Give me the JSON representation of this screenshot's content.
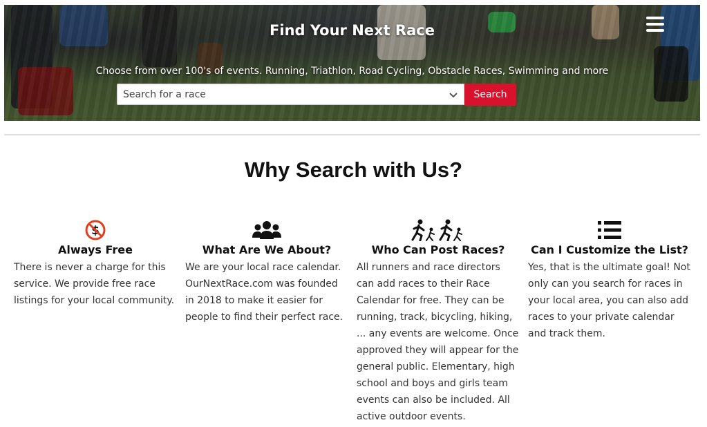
{
  "hero": {
    "title": "Find Your Next Race",
    "subtitle": "Choose from over 100's of events. Running, Triathlon, Road Cycling, Obstacle Races, Swimming and more",
    "menu_icon": "hamburger-menu-icon"
  },
  "search": {
    "placeholder": "Search for a race",
    "button_label": "Search",
    "button_color": "#d9112d"
  },
  "why": {
    "title": "Why Search with Us?"
  },
  "features": [
    {
      "icon": "no-dollar-icon",
      "title": "Always Free",
      "text": "There is never a charge for this service. We provide free race listings for your local community."
    },
    {
      "icon": "users-icon",
      "title": "What Are We About?",
      "text": "We are your local race calendar. OurNextRace.com was founded in 2018 to make it easier for people to find their perfect race."
    },
    {
      "icon": "running-family-icon",
      "title": "Who Can Post Races?",
      "text": "All runners and race directors can add races to their Race Calendar for free. They can be running, track, bicycling, hiking, ... any events are welcome. Once approved they will appear for the general public. Elementary, high school and boys and girls team events can also be included. All active outdoor events."
    },
    {
      "icon": "list-icon",
      "title": "Can I Customize the List?",
      "text": "Yes, that is the ultimate goal! Not only can you search for races in your local area, you can also add races to your private calendar and track them."
    }
  ]
}
